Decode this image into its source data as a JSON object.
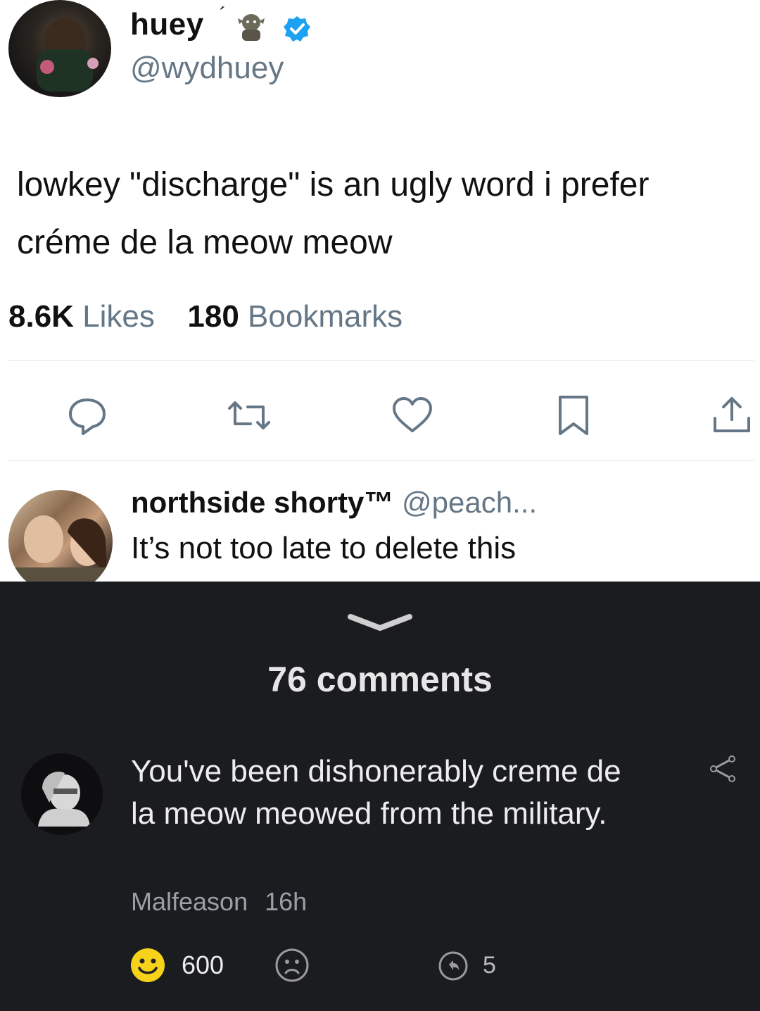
{
  "tweet": {
    "display_name": "huey",
    "accent_mark": "´",
    "handle": "@wydhuey",
    "text_line1": "lowkey \"discharge\" is an ugly word i prefer",
    "text_line2": "créme de la meow meow",
    "likes_count": "8.6K",
    "likes_label": "Likes",
    "bookmarks_count": "180",
    "bookmarks_label": "Bookmarks",
    "actions": [
      "reply-icon",
      "retweet-icon",
      "like-icon",
      "bookmark-icon",
      "share-icon"
    ],
    "colors": {
      "verified": "#1da1f2",
      "muted": "#657786",
      "divider": "#e1e8ed"
    }
  },
  "reply": {
    "name": "northside shorty™",
    "handle": "@peach...",
    "text": "It’s not too late to delete this"
  },
  "comments": {
    "count_label": "76 comments",
    "comment": {
      "text": "You've been dishonerably creme de la meow meowed from the military.",
      "author": "Malfeason",
      "time": "16h",
      "upvotes": "600",
      "replies": "5"
    },
    "colors": {
      "background": "#1b1c20",
      "smile": "#f7d21a"
    }
  }
}
